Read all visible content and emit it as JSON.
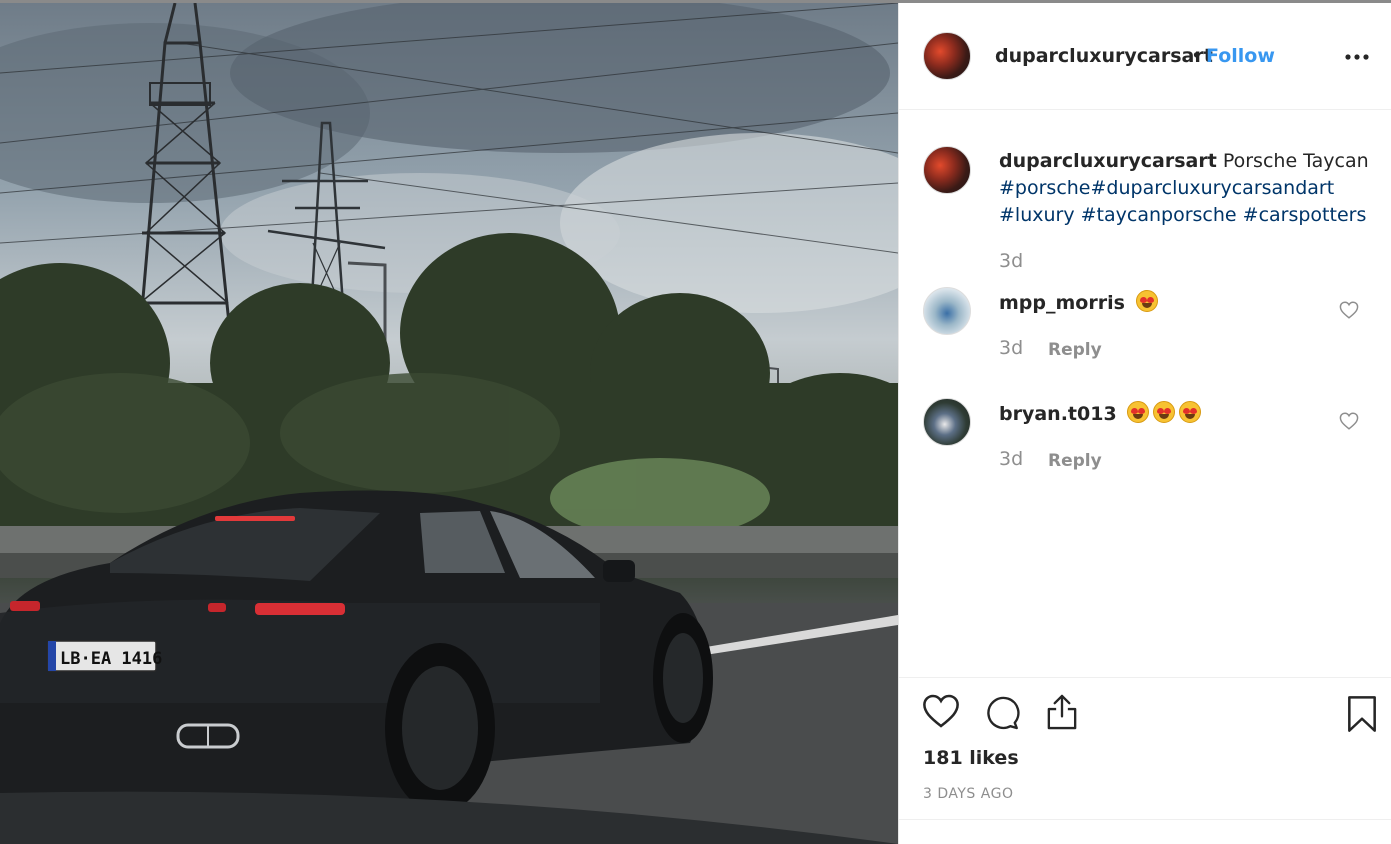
{
  "post": {
    "owner": "duparcluxurycarsart",
    "separator": "•",
    "follow_label": "Follow",
    "more_label": "•••",
    "caption_user": "duparcluxurycarsart",
    "caption_text": "Porsche Taycan",
    "hashtags": [
      "#porsche",
      "#duparcluxurycarsandart",
      "#luxury",
      "#taycanporsche",
      "#carspotters"
    ],
    "caption_time": "3d",
    "photo_plate": "LB·EA 1416"
  },
  "comments": [
    {
      "user": "mpp_morris",
      "emoji_count": 1,
      "time": "3d",
      "reply_label": "Reply"
    },
    {
      "user": "bryan.t013",
      "emoji_count": 3,
      "time": "3d",
      "reply_label": "Reply"
    }
  ],
  "footer": {
    "likes": "181 likes",
    "posted": "3 DAYS AGO"
  },
  "colors": {
    "follow": "#3897f0",
    "hashtag": "#003569",
    "muted": "#8e8e8e",
    "text": "#262626"
  },
  "icons": [
    "heart-icon",
    "comment-icon",
    "share-icon",
    "bookmark-icon",
    "heart-small-icon",
    "more-icon"
  ]
}
